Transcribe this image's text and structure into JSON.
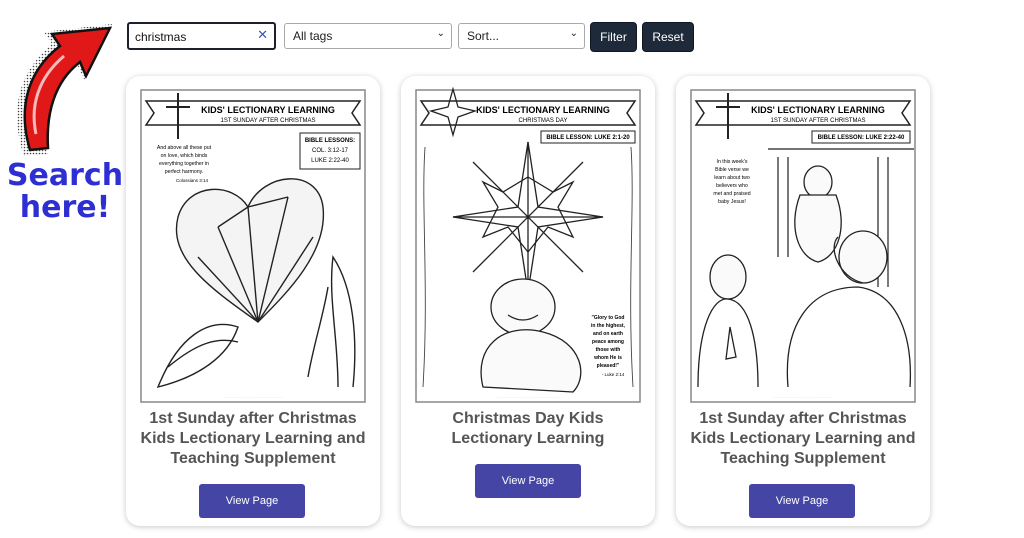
{
  "search": {
    "value": "christmas",
    "clear_icon": "close-icon"
  },
  "filters": {
    "tags_selected": "All tags",
    "sort_selected": "Sort...",
    "filter_label": "Filter",
    "reset_label": "Reset"
  },
  "annotation": {
    "line1": "Search",
    "line2": "here!"
  },
  "cards": [
    {
      "banner_title": "KIDS' LECTIONARY LEARNING",
      "banner_sub": "1ST SUNDAY AFTER CHRISTMAS",
      "lesson_header": "BIBLE LESSONS:",
      "lessons": [
        "COL. 3:12-17",
        "LUKE 2:22-40"
      ],
      "verse": [
        "And above all these put",
        "on love, which binds",
        "everything together in",
        "perfect harmony."
      ],
      "verse_ref": "Colossians 3:14",
      "title": [
        "1st Sunday after Christmas",
        "Kids Lectionary Learning and",
        "Teaching Supplement"
      ],
      "button": "View Page"
    },
    {
      "banner_title": "KIDS' LECTIONARY LEARNING",
      "banner_sub": "CHRISTMAS DAY",
      "lesson_header": "BIBLE LESSON: LUKE 2:1-20",
      "verse": [
        "\"Glory to God",
        "in the highest,",
        "and on earth",
        "peace among",
        "those with",
        "whom He is",
        "pleased!\""
      ],
      "verse_ref": "- Luke 2:14",
      "title": [
        "Christmas Day Kids",
        "Lectionary Learning"
      ],
      "button": "View Page"
    },
    {
      "banner_title": "KIDS' LECTIONARY LEARNING",
      "banner_sub": "1ST SUNDAY AFTER CHRISTMAS",
      "lesson_header": "BIBLE LESSON: LUKE 2:22-40",
      "verse": [
        "In this week's",
        "Bible verse we",
        "learn about two",
        "believers who",
        "met and praised",
        "baby Jesus!"
      ],
      "title": [
        "1st Sunday after Christmas",
        "Kids Lectionary Learning and",
        "Teaching Supplement"
      ],
      "button": "View Page"
    }
  ]
}
